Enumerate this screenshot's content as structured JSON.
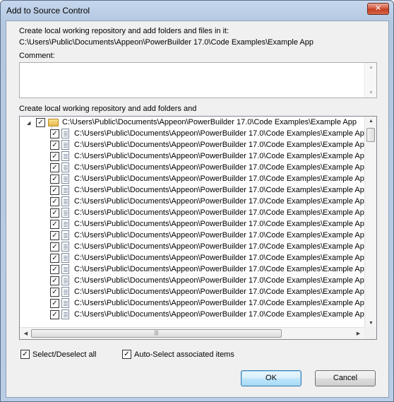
{
  "window": {
    "title": "Add to Source Control",
    "close_glyph": "✕"
  },
  "header": {
    "description": "Create local working repository and add folders and files in it:",
    "path": "C:\\Users\\Public\\Documents\\Appeon\\PowerBuilder 17.0\\Code Examples\\Example App"
  },
  "comment": {
    "label": "Comment:",
    "value": ""
  },
  "tree_section": {
    "label": "Create local working repository and add folders and",
    "root": {
      "label": "C:\\Users\\Public\\Documents\\Appeon\\PowerBuilder 17.0\\Code Examples\\Example App",
      "checked": true,
      "expanded": true
    },
    "items": [
      {
        "label": "C:\\Users\\Public\\Documents\\Appeon\\PowerBuilder 17.0\\Code Examples\\Example App\\",
        "checked": true
      },
      {
        "label": "C:\\Users\\Public\\Documents\\Appeon\\PowerBuilder 17.0\\Code Examples\\Example App\\",
        "checked": true
      },
      {
        "label": "C:\\Users\\Public\\Documents\\Appeon\\PowerBuilder 17.0\\Code Examples\\Example App\\",
        "checked": true
      },
      {
        "label": "C:\\Users\\Public\\Documents\\Appeon\\PowerBuilder 17.0\\Code Examples\\Example App\\",
        "checked": true
      },
      {
        "label": "C:\\Users\\Public\\Documents\\Appeon\\PowerBuilder 17.0\\Code Examples\\Example App\\",
        "checked": true
      },
      {
        "label": "C:\\Users\\Public\\Documents\\Appeon\\PowerBuilder 17.0\\Code Examples\\Example App\\",
        "checked": true
      },
      {
        "label": "C:\\Users\\Public\\Documents\\Appeon\\PowerBuilder 17.0\\Code Examples\\Example App\\",
        "checked": true
      },
      {
        "label": "C:\\Users\\Public\\Documents\\Appeon\\PowerBuilder 17.0\\Code Examples\\Example App\\",
        "checked": true
      },
      {
        "label": "C:\\Users\\Public\\Documents\\Appeon\\PowerBuilder 17.0\\Code Examples\\Example App\\",
        "checked": true
      },
      {
        "label": "C:\\Users\\Public\\Documents\\Appeon\\PowerBuilder 17.0\\Code Examples\\Example App\\",
        "checked": true
      },
      {
        "label": "C:\\Users\\Public\\Documents\\Appeon\\PowerBuilder 17.0\\Code Examples\\Example App\\",
        "checked": true
      },
      {
        "label": "C:\\Users\\Public\\Documents\\Appeon\\PowerBuilder 17.0\\Code Examples\\Example App\\",
        "checked": true
      },
      {
        "label": "C:\\Users\\Public\\Documents\\Appeon\\PowerBuilder 17.0\\Code Examples\\Example App\\",
        "checked": true
      },
      {
        "label": "C:\\Users\\Public\\Documents\\Appeon\\PowerBuilder 17.0\\Code Examples\\Example App\\",
        "checked": true
      },
      {
        "label": "C:\\Users\\Public\\Documents\\Appeon\\PowerBuilder 17.0\\Code Examples\\Example App\\",
        "checked": true
      },
      {
        "label": "C:\\Users\\Public\\Documents\\Appeon\\PowerBuilder 17.0\\Code Examples\\Example App\\",
        "checked": true
      },
      {
        "label": "C:\\Users\\Public\\Documents\\Appeon\\PowerBuilder 17.0\\Code Examples\\Example App\\",
        "checked": true
      }
    ],
    "icons": {
      "root": "folder-open-icon",
      "item": "file-icon",
      "expander": "collapse-triangle-icon"
    },
    "scroll_glyphs": {
      "up": "▲",
      "down": "▼",
      "left": "◀",
      "right": "▶",
      "grip": "|||"
    }
  },
  "options": {
    "select_all": {
      "label": "Select/Deselect all",
      "checked": true
    },
    "auto_select": {
      "label": "Auto-Select associated items",
      "checked": true
    }
  },
  "buttons": {
    "ok": "OK",
    "cancel": "Cancel"
  }
}
